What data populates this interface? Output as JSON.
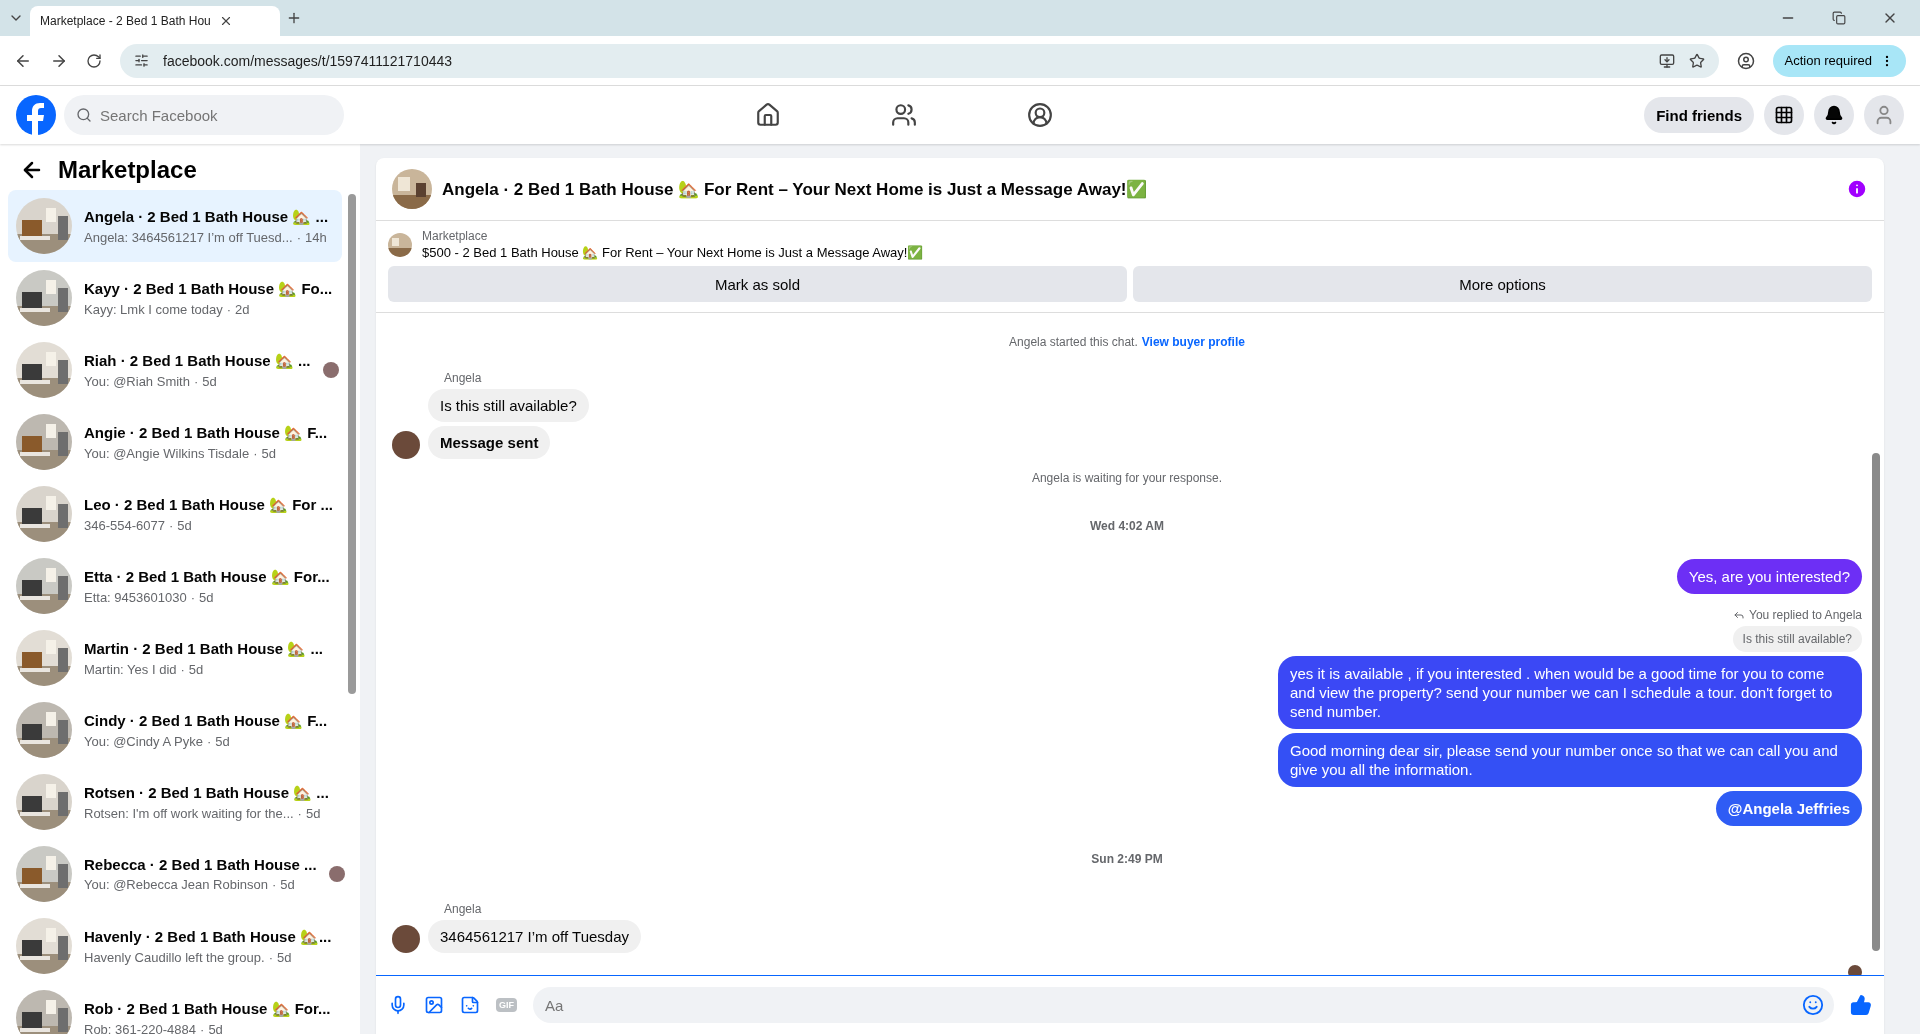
{
  "browser": {
    "tabs": [
      {
        "title": "Marketplace - 2 Bed 1 Bath Hou",
        "selected": true
      }
    ],
    "url": "facebook.com/messages/t/1597411121710443",
    "action_button": "Action required"
  },
  "header": {
    "search": {
      "placeholder": "Search Facebook"
    },
    "find_friends": "Find friends"
  },
  "sidebar": {
    "title": "Marketplace",
    "separator": "·",
    "conversations": [
      {
        "title": "Angela · 2 Bed 1 Bath House 🏡 ...",
        "preview": "Angela: 3464561217 I’m off Tuesd...",
        "time": "14h",
        "selected": true,
        "seen_avatar": false
      },
      {
        "title": "Kayy · 2 Bed 1 Bath House 🏡 Fo...",
        "preview": "Kayy: Lmk I come today",
        "time": "2d",
        "selected": false,
        "seen_avatar": false
      },
      {
        "title": "Riah · 2 Bed 1 Bath House 🏡 ...",
        "preview": "You: @Riah Smith",
        "time": "5d",
        "selected": false,
        "seen_avatar": true
      },
      {
        "title": "Angie · 2 Bed 1 Bath House 🏡 F...",
        "preview": "You: @Angie Wilkins Tisdale",
        "time": "5d",
        "selected": false,
        "seen_avatar": false
      },
      {
        "title": "Leo · 2 Bed 1 Bath House 🏡 For ...",
        "preview": "346-554-6077",
        "time": "5d",
        "selected": false,
        "seen_avatar": false
      },
      {
        "title": "Etta · 2 Bed 1 Bath House 🏡 For...",
        "preview": "Etta: 9453601030",
        "time": "5d",
        "selected": false,
        "seen_avatar": false
      },
      {
        "title": "Martin · 2 Bed 1 Bath House 🏡 ...",
        "preview": "Martin: Yes I did",
        "time": "5d",
        "selected": false,
        "seen_avatar": false
      },
      {
        "title": "Cindy · 2 Bed 1 Bath House 🏡 F...",
        "preview": "You: @Cindy A Pyke",
        "time": "5d",
        "selected": false,
        "seen_avatar": false
      },
      {
        "title": "Rotsen · 2 Bed 1 Bath House 🏡 ...",
        "preview": "Rotsen: I'm off work waiting for the...",
        "time": "5d",
        "selected": false,
        "seen_avatar": false
      },
      {
        "title": "Rebecca · 2 Bed 1 Bath House ...",
        "preview": "You: @Rebecca Jean Robinson",
        "time": "5d",
        "selected": false,
        "seen_avatar": true
      },
      {
        "title": "Havenly · 2 Bed 1 Bath House 🏡...",
        "preview": "Havenly Caudillo left the group.",
        "time": "5d",
        "selected": false,
        "seen_avatar": false
      },
      {
        "title": "Rob · 2 Bed 1 Bath House 🏡 For...",
        "preview": "Rob: 361-220-4884",
        "time": "5d",
        "selected": false,
        "seen_avatar": false
      }
    ]
  },
  "chat": {
    "title": "Angela · 2 Bed 1 Bath House 🏡 For Rent – Your Next Home is Just a Message Away!✅",
    "listing": {
      "label": "Marketplace",
      "title": "$500 - 2 Bed 1 Bath House 🏡 For Rent – Your Next Home is Just a Message Away!✅"
    },
    "buttons": [
      "Mark as sold",
      "More options"
    ],
    "messages": [
      {
        "kind": "system",
        "text": "Angela started this chat.",
        "link": "View buyer profile"
      },
      {
        "kind": "sender",
        "text": "Angela"
      },
      {
        "kind": "incoming",
        "text": "Is this still available?",
        "avatar": false,
        "bold": false
      },
      {
        "kind": "incoming",
        "text": "Message sent",
        "avatar": true,
        "bold": true
      },
      {
        "kind": "system",
        "text": "Angela is waiting for your response."
      },
      {
        "kind": "timestamp",
        "text": "Wed 4:02 AM"
      },
      {
        "kind": "outgoing",
        "text": "Yes, are you interested?",
        "color": "#6d2ff5",
        "bold": false
      },
      {
        "kind": "reply_note",
        "text": "You replied to Angela"
      },
      {
        "kind": "quoted",
        "text": "Is this still available?"
      },
      {
        "kind": "outgoing",
        "text": "yes it is available , if you interested . when would be  a good time for you to come and view the  property? send your number we can I schedule  a tour. don't forget to send  number.",
        "color": "#3b48f5",
        "bold": false
      },
      {
        "kind": "outgoing",
        "text": "Good morning dear sir, please send your number once so that we can call you and give you all the information.",
        "color": "#3450f5",
        "bold": false
      },
      {
        "kind": "outgoing",
        "text": "@Angela Jeffries",
        "color": "#2f5cf5",
        "bold": true
      },
      {
        "kind": "timestamp",
        "text": "Sun 2:49 PM"
      },
      {
        "kind": "sender",
        "text": "Angela"
      },
      {
        "kind": "incoming",
        "text": "3464561217 I’m off Tuesday",
        "avatar": true,
        "bold": false
      }
    ]
  },
  "composer": {
    "placeholder": "Aa",
    "gif_label": "GIF"
  }
}
